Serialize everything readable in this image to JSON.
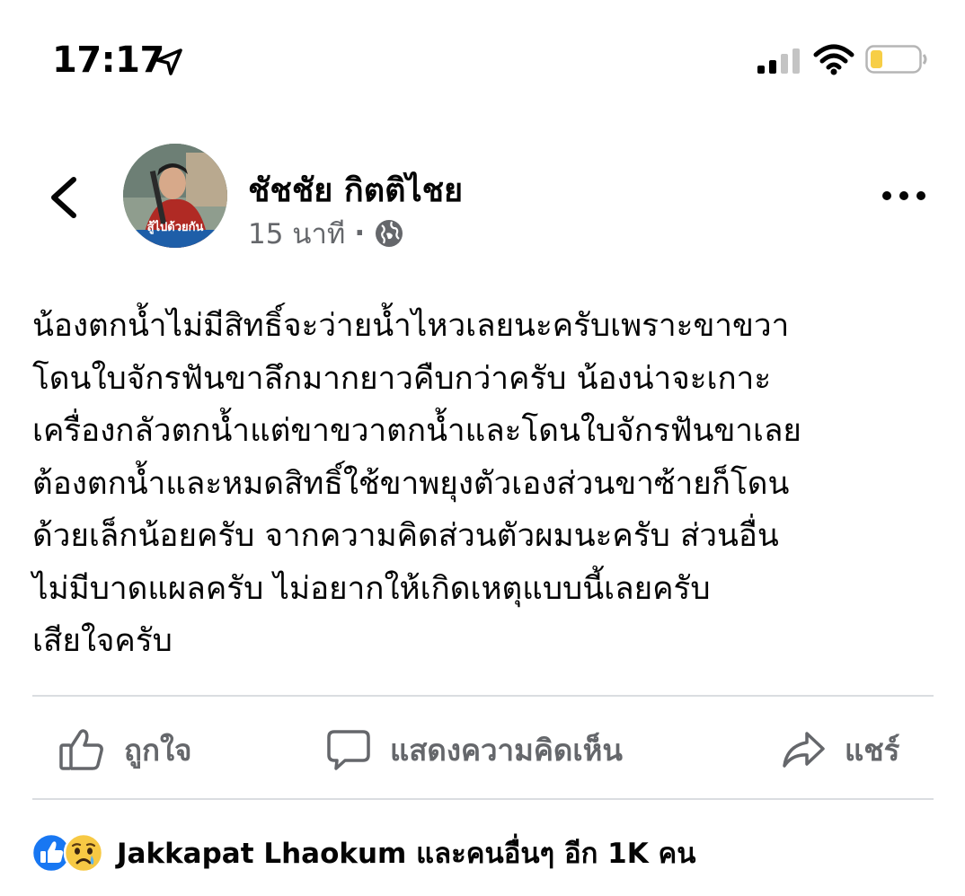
{
  "status_bar": {
    "time": "17:17"
  },
  "post": {
    "author_name": "ชัชชัย กิตติไชย",
    "avatar_caption": "สู้ไปด้วยกัน",
    "timestamp": "15 นาที",
    "separator": "·",
    "body_lines": [
      "น้องตกน้ำไม่มีสิทธิ์จะว่ายน้ำไหวเลยนะครับเพราะขาขวา",
      "โดนใบจักรฟันขาลึกมากยาวคืบกว่าครับ น้องน่าจะเกาะ",
      "เครื่องกลัวตกน้ำแต่ขาขวาตกน้ำและโดนใบจักรฟันขาเลย",
      "ต้องตกน้ำและหมดสิทธิ์ใช้ขาพยุงตัวเองส่วนขาซ้ายก็โดน",
      "ด้วยเล็กน้อยครับ จากความคิดส่วนตัวผมนะครับ ส่วนอื่น",
      "ไม่มีบาดแผลครับ ไม่อยากให้เกิดเหตุแบบนี้เลยครับ",
      "เสียใจครับ"
    ]
  },
  "actions": {
    "like_label": "ถูกใจ",
    "comment_label": "แสดงความคิดเห็น",
    "share_label": "แชร์"
  },
  "reactions": {
    "summary": "Jakkapat Lhaokum และคนอื่นๆ อีก 1K คน"
  },
  "icons": {
    "back": "chevron-left-icon",
    "more": "more-horizontal-icon",
    "globe": "globe-icon",
    "like": "thumbs-up-icon",
    "comment": "comment-bubble-icon",
    "share": "share-arrow-icon"
  },
  "colors": {
    "text_primary": "#050505",
    "text_secondary": "#65676b",
    "divider": "#dadde1",
    "like_blue": "#1877f2",
    "sad_yellow": "#f7c944",
    "battery_low": "#f7ce46"
  }
}
